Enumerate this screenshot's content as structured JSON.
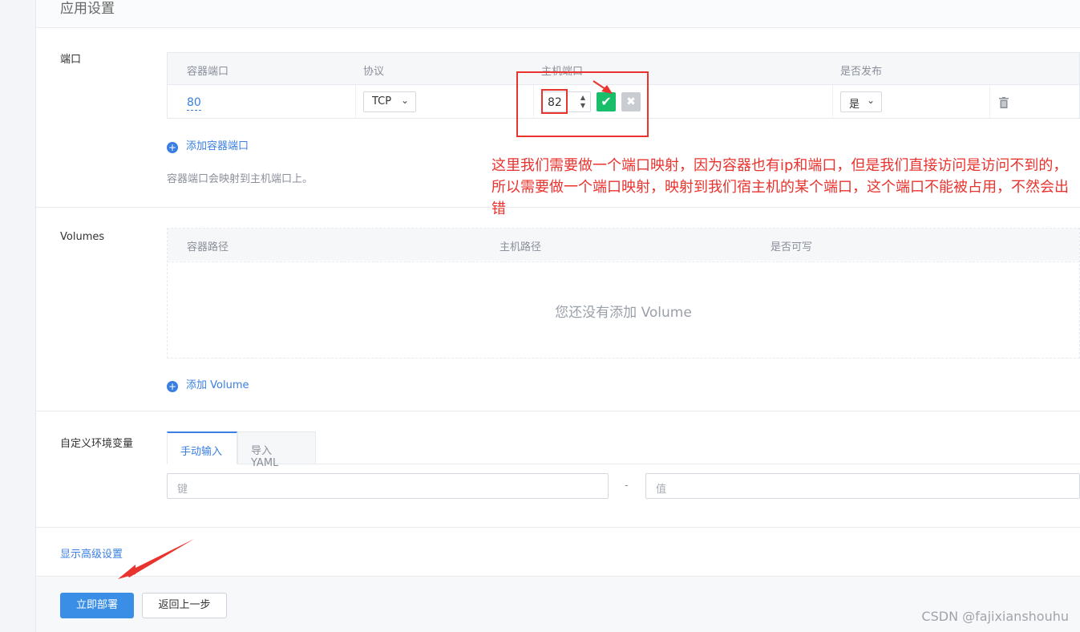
{
  "section": {
    "title": "应用设置"
  },
  "ports": {
    "label": "端口",
    "headers": [
      "容器端口",
      "协议",
      "主机端口",
      "是否发布"
    ],
    "row": {
      "container_port": "80",
      "protocol": "TCP",
      "host_port": "82",
      "publish": "是"
    },
    "add_label": "添加容器端口",
    "hint": "容器端口会映射到主机端口上。"
  },
  "volumes": {
    "label": "Volumes",
    "headers": [
      "容器路径",
      "主机路径",
      "是否可写"
    ],
    "empty_text": "您还没有添加 Volume",
    "add_label": "添加 Volume"
  },
  "env": {
    "label": "自定义环境变量",
    "tabs": [
      "手动输入",
      "导入 YAML"
    ],
    "key_placeholder": "键",
    "separator": "-",
    "value_placeholder": "值"
  },
  "advanced": {
    "label": "显示高级设置"
  },
  "actions": {
    "deploy_label": "立即部署",
    "back_label": "返回上一步"
  },
  "annotation": {
    "text": "这里我们需要做一个端口映射，因为容器也有ip和端口，但是我们直接访问是访问不到的，所以需要做一个端口映射，映射到我们宿主机的某个端口，这个端口不能被占用，不然会出错"
  },
  "watermark": "CSDN @fajixianshouhu",
  "icons": {
    "check": "check-icon",
    "close": "close-icon",
    "trash": "trash-icon",
    "plus": "plus-circle-icon",
    "chevron": "chevron-down-icon"
  },
  "colors": {
    "accent": "#3a7fe0",
    "success": "#19be6b",
    "annotation": "#e8332e"
  }
}
